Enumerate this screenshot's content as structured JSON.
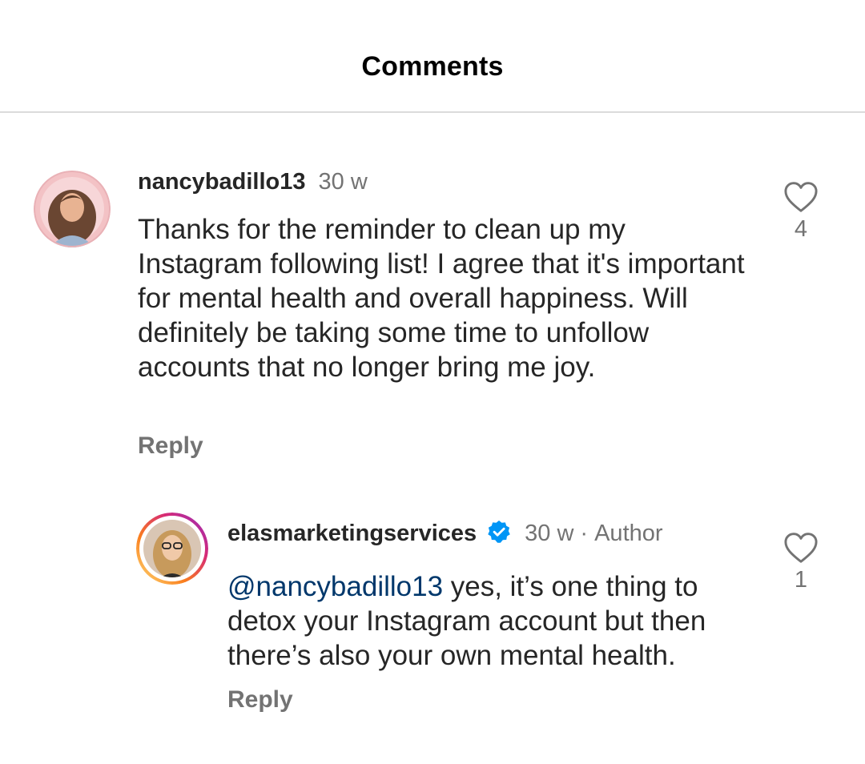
{
  "header": {
    "title": "Comments"
  },
  "comments": [
    {
      "username": "nancybadillo13",
      "time": "30 w",
      "text": "Thanks for the reminder to clean up my Instagram following list! I agree that it's important for mental health and overall happiness. Will definitely be taking some time to unfollow accounts that no longer bring me joy.",
      "reply_label": "Reply",
      "likes": "4",
      "avatar_icon": "profile-photo"
    }
  ],
  "replies": [
    {
      "username": "elasmarketingservices",
      "verified": true,
      "time": "30 w",
      "separator": "·",
      "author_label": "Author",
      "mention": "@nancybadillo13",
      "text": " yes, it’s one thing to detox your Instagram account but then there’s also your own mental health.",
      "reply_label": "Reply",
      "likes": "1",
      "avatar_icon": "profile-photo",
      "story_ring_colors": [
        "#feda75",
        "#fa7e1e",
        "#d62976",
        "#962fbf"
      ]
    }
  ],
  "colors": {
    "text": "#262626",
    "secondary": "#737373",
    "mention": "#00376b",
    "verified_badge": "#0095f6",
    "divider": "#dbdbdb"
  }
}
